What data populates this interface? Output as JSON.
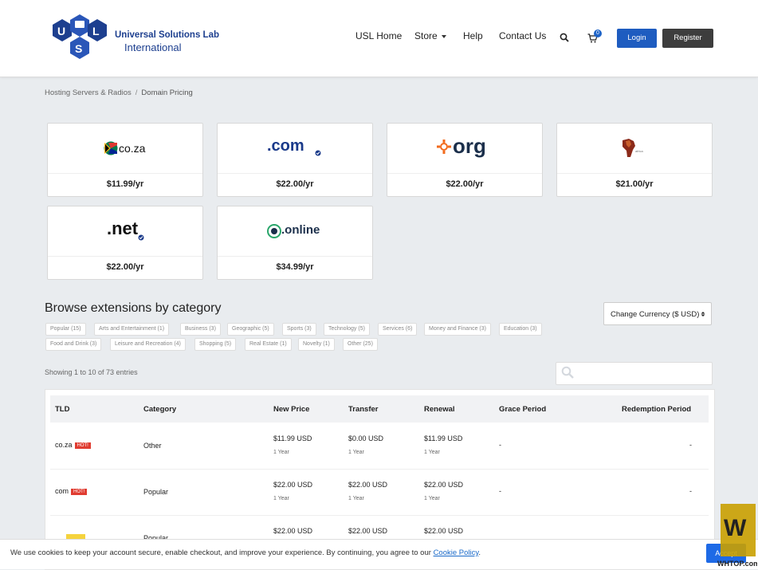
{
  "header": {
    "logo_line1": "Universal Solutions Lab",
    "logo_line2": "International",
    "nav": {
      "home": "USL Home",
      "store": "Store",
      "help": "Help",
      "contact": "Contact Us"
    },
    "cart_count": "0",
    "login": "Login",
    "register": "Register"
  },
  "breadcrumb": {
    "parent": "Hosting Servers & Radios",
    "separator": "/",
    "current": "Domain Pricing"
  },
  "featured_tlds": [
    {
      "logo_text": "co.za",
      "price": "$11.99/yr"
    },
    {
      "logo_text": ".com",
      "price": "$22.00/yr"
    },
    {
      "logo_text": "org",
      "price": "$22.00/yr"
    },
    {
      "logo_text": "africa",
      "price": "$21.00/yr"
    },
    {
      "logo_text": ".net",
      "price": "$22.00/yr"
    },
    {
      "logo_text": ".online",
      "price": "$34.99/yr"
    }
  ],
  "browse": {
    "title": "Browse extensions by category",
    "currency_label": "Change Currency ($ USD)",
    "categories": [
      "Popular (15)",
      "Arts and Entertainment (1)",
      "Business (3)",
      "Geographic (5)",
      "Sports (3)",
      "Technology (5)",
      "Services (6)",
      "Money and Finance (3)",
      "Education (3)",
      "Food and Drink (3)",
      "Leisure and Recreation (4)",
      "Shopping (5)",
      "Real Estate (1)",
      "Novelty (1)",
      "Other (25)"
    ]
  },
  "table": {
    "showing": "Showing 1 to 10 of 73 entries",
    "search_placeholder": "",
    "headers": [
      "TLD",
      "Category",
      "New Price",
      "Transfer",
      "Renewal",
      "Grace Period",
      "Redemption Period"
    ],
    "hot_label": "HOT!",
    "rows": [
      {
        "tld": "co.za",
        "hot": true,
        "category": "Other",
        "new_price": "$11.99 USD",
        "new_term": "1 Year",
        "transfer": "$0.00 USD",
        "transfer_term": "1 Year",
        "renewal": "$11.99 USD",
        "renewal_term": "1 Year",
        "grace": "-",
        "redemption": "-"
      },
      {
        "tld": "com",
        "hot": true,
        "category": "Popular",
        "new_price": "$22.00 USD",
        "new_term": "1 Year",
        "transfer": "$22.00 USD",
        "transfer_term": "1 Year",
        "renewal": "$22.00 USD",
        "renewal_term": "1 Year",
        "grace": "-",
        "redemption": "-"
      },
      {
        "tld": "",
        "hot": false,
        "category": "Popular",
        "new_price": "$22.00 USD",
        "new_term": "",
        "transfer": "$22.00 USD",
        "transfer_term": "",
        "renewal": "$22.00 USD",
        "renewal_term": "",
        "grace": "",
        "redemption": ""
      }
    ]
  },
  "cookie": {
    "text": "We use cookies to keep your account secure, enable checkout, and improve your experience. By continuing, you agree to our ",
    "link": "Cookie Policy",
    "end": ".",
    "accept": "Accept"
  },
  "watermark": {
    "text": "WHTOP.com"
  },
  "colors": {
    "brand_blue": "#1d3f8f",
    "login_blue": "#1e5cc0",
    "register_dark": "#3d3d3d",
    "hot_red": "#e03c31",
    "background": "#e9ecef"
  }
}
